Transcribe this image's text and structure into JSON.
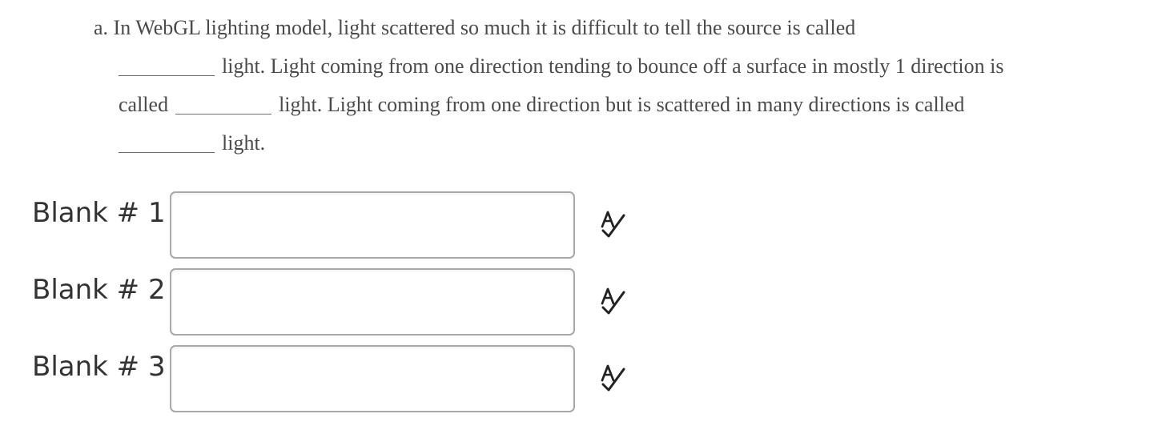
{
  "question": {
    "prefix": "a.",
    "line1": "In WebGL lighting model, light scattered so much it is difficult to tell the source is called",
    "line2_after_blank": "light.  Light coming from one direction tending to bounce off a surface in mostly 1 direction is",
    "line3_before_blank": "called",
    "line3_after_blank": "light.  Light coming from one direction but is scattered in many directions is called",
    "line4_after_blank": "light."
  },
  "blanks": [
    {
      "label": "Blank # 1",
      "value": "",
      "icon": "spell-check-icon"
    },
    {
      "label": "Blank # 2",
      "value": "",
      "icon": "spell-check-icon"
    },
    {
      "label": "Blank # 3",
      "value": "",
      "icon": "spell-check-icon"
    }
  ],
  "colors": {
    "question_text": "#4a4a4a",
    "label_text": "#333333",
    "input_border": "#a9a9a9",
    "icon": "#222222"
  }
}
